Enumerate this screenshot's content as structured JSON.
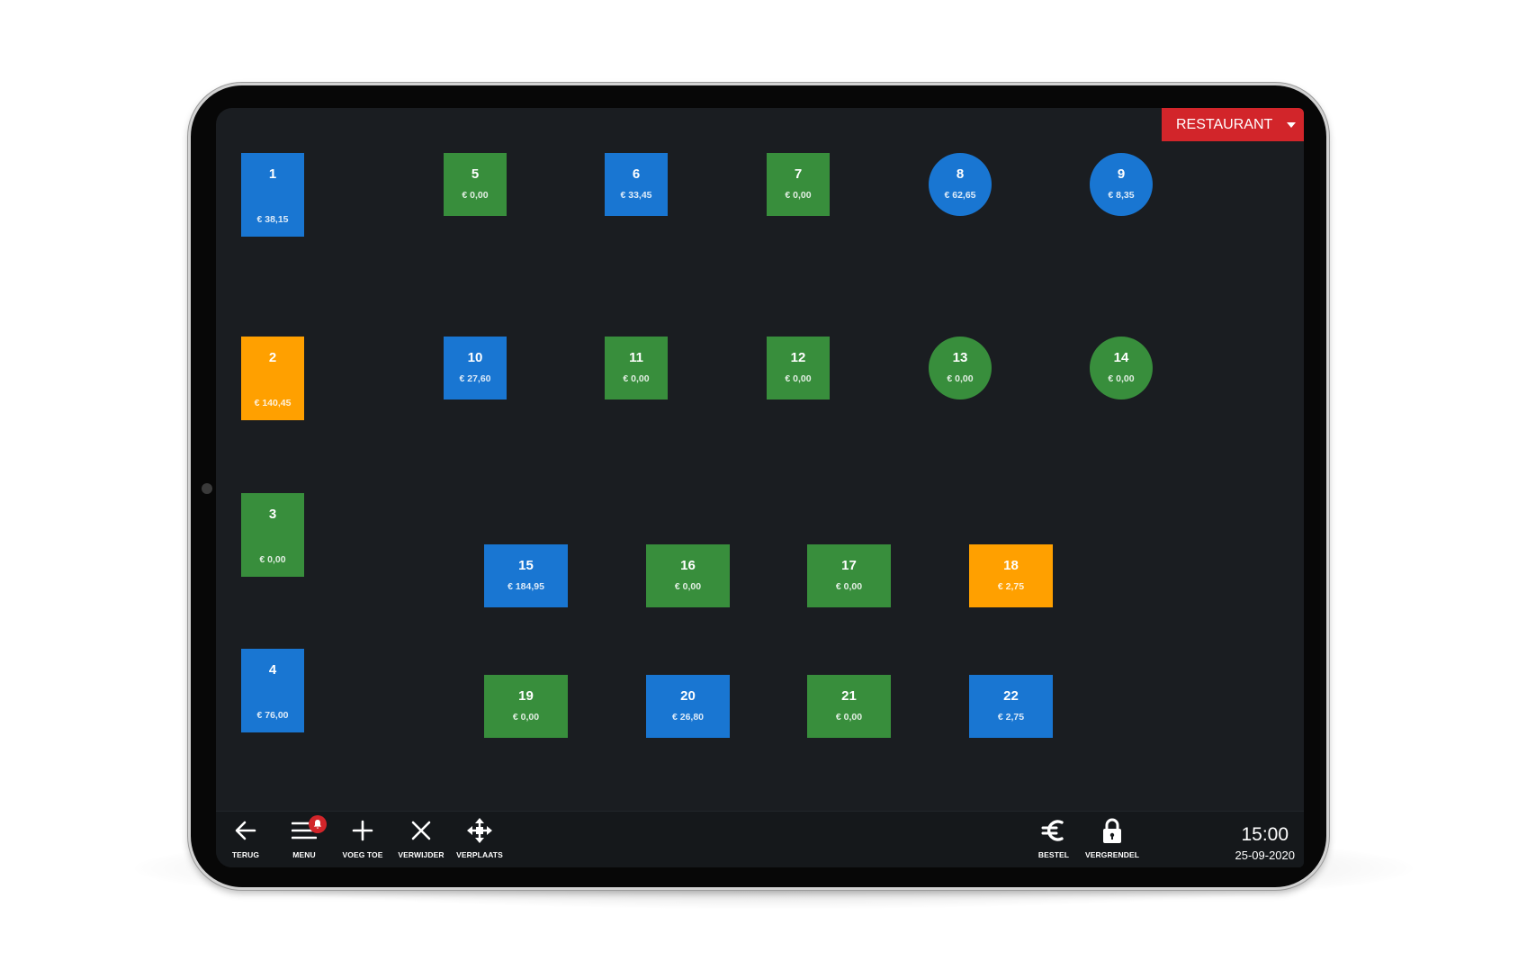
{
  "area_selector": {
    "label": "RESTAURANT"
  },
  "colors": {
    "available": "#388e3c",
    "occupied": "#1976d2",
    "attention": "#ffa000",
    "area_button": "#d2252a",
    "screen_background": "#1a1d21"
  },
  "tables": [
    {
      "number": "1",
      "amount": "€ 38,15",
      "status": "occupied",
      "shape": "rect"
    },
    {
      "number": "2",
      "amount": "€ 140,45",
      "status": "attention",
      "shape": "rect"
    },
    {
      "number": "3",
      "amount": "€ 0,00",
      "status": "available",
      "shape": "rect"
    },
    {
      "number": "4",
      "amount": "€ 76,00",
      "status": "occupied",
      "shape": "rect"
    },
    {
      "number": "5",
      "amount": "€ 0,00",
      "status": "available",
      "shape": "square"
    },
    {
      "number": "6",
      "amount": "€ 33,45",
      "status": "occupied",
      "shape": "square"
    },
    {
      "number": "7",
      "amount": "€ 0,00",
      "status": "available",
      "shape": "square"
    },
    {
      "number": "8",
      "amount": "€ 62,65",
      "status": "occupied",
      "shape": "round"
    },
    {
      "number": "9",
      "amount": "€ 8,35",
      "status": "occupied",
      "shape": "round"
    },
    {
      "number": "10",
      "amount": "€ 27,60",
      "status": "occupied",
      "shape": "square"
    },
    {
      "number": "11",
      "amount": "€ 0,00",
      "status": "available",
      "shape": "square"
    },
    {
      "number": "12",
      "amount": "€ 0,00",
      "status": "available",
      "shape": "square"
    },
    {
      "number": "13",
      "amount": "€ 0,00",
      "status": "available",
      "shape": "round"
    },
    {
      "number": "14",
      "amount": "€ 0,00",
      "status": "available",
      "shape": "round"
    },
    {
      "number": "15",
      "amount": "€ 184,95",
      "status": "occupied",
      "shape": "wide"
    },
    {
      "number": "16",
      "amount": "€ 0,00",
      "status": "available",
      "shape": "wide"
    },
    {
      "number": "17",
      "amount": "€ 0,00",
      "status": "available",
      "shape": "wide"
    },
    {
      "number": "18",
      "amount": "€ 2,75",
      "status": "attention",
      "shape": "wide"
    },
    {
      "number": "19",
      "amount": "€ 0,00",
      "status": "available",
      "shape": "wide"
    },
    {
      "number": "20",
      "amount": "€ 26,80",
      "status": "occupied",
      "shape": "wide"
    },
    {
      "number": "21",
      "amount": "€ 0,00",
      "status": "available",
      "shape": "wide"
    },
    {
      "number": "22",
      "amount": "€ 2,75",
      "status": "occupied",
      "shape": "wide"
    }
  ],
  "toolbar": {
    "back_label": "TERUG",
    "menu_label": "MENU",
    "add_label": "VOEG TOE",
    "remove_label": "VERWIJDER",
    "move_label": "VERPLAATS",
    "order_label": "BESTEL",
    "lock_label": "VERGRENDEL",
    "time": "15:00",
    "date": "25-09-2020",
    "icons": {
      "back": "arrow-left-icon",
      "menu": "hamburger-menu-icon",
      "notification": "bell-icon",
      "add": "plus-icon",
      "remove": "close-icon",
      "move": "move-arrows-icon",
      "order": "euro-icon",
      "lock": "lock-icon"
    }
  }
}
